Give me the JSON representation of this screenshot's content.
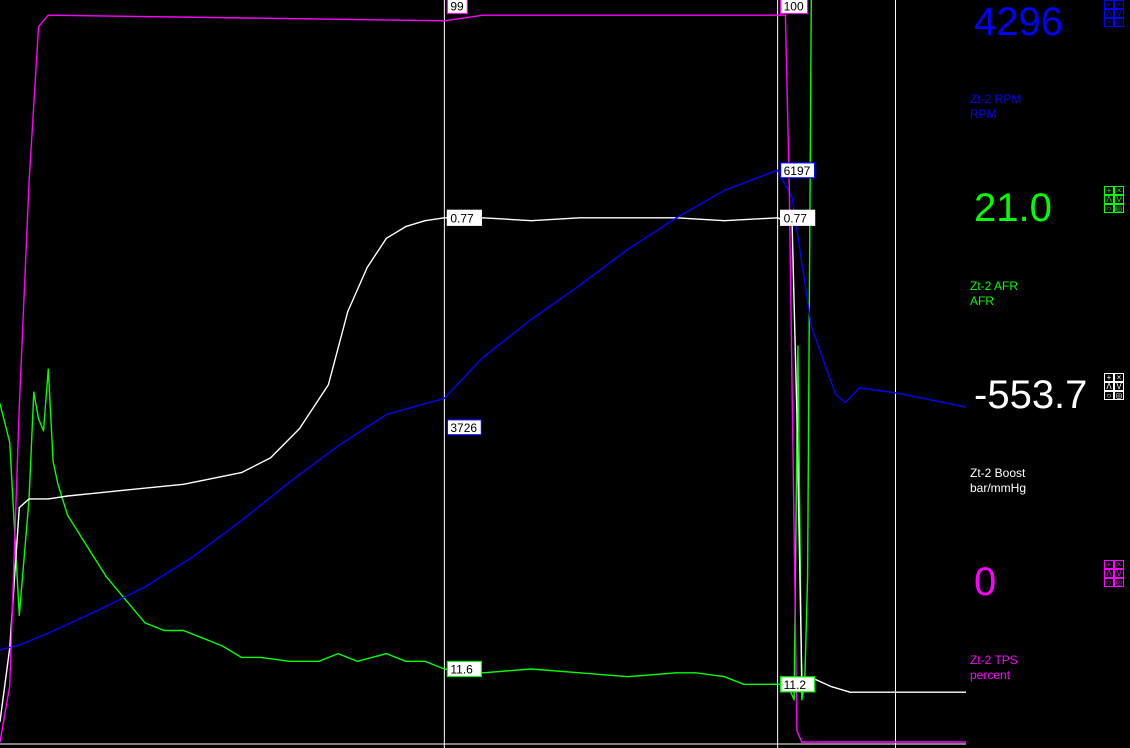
{
  "chart_data": {
    "type": "line",
    "x_range": [
      0,
      100
    ],
    "cursors": [
      {
        "x": 46,
        "values": {
          "tps": "99",
          "rpm": "3726",
          "boost": "0.77",
          "afr": "11.6"
        }
      },
      {
        "x": 80.5,
        "values": {
          "tps": "100",
          "rpm": "6197",
          "boost": "0.77",
          "afr": "11.2"
        }
      }
    ],
    "extra_gridline_x": 92.7,
    "series": [
      {
        "key": "rpm",
        "name": "Zt-2 RPM",
        "color": "#0000ff",
        "ylim": [
          0,
          8000
        ],
        "points": [
          [
            0,
            1000
          ],
          [
            2,
            1050
          ],
          [
            5,
            1180
          ],
          [
            10,
            1420
          ],
          [
            15,
            1680
          ],
          [
            20,
            2010
          ],
          [
            25,
            2400
          ],
          [
            30,
            2820
          ],
          [
            35,
            3210
          ],
          [
            40,
            3550
          ],
          [
            46,
            3726
          ],
          [
            50,
            4170
          ],
          [
            55,
            4580
          ],
          [
            60,
            4950
          ],
          [
            65,
            5340
          ],
          [
            70,
            5680
          ],
          [
            75,
            5980
          ],
          [
            80.5,
            6197
          ],
          [
            82,
            5900
          ],
          [
            84,
            4500
          ],
          [
            86.5,
            3770
          ],
          [
            87.5,
            3680
          ],
          [
            89,
            3840
          ],
          [
            93,
            3780
          ],
          [
            100,
            3630
          ]
        ]
      },
      {
        "key": "afr",
        "name": "Zt-2 AFR",
        "color": "#00ff00",
        "ylim": [
          9.7,
          28.9
        ],
        "points": [
          [
            0,
            18.5
          ],
          [
            1,
            17.5
          ],
          [
            2,
            13.0
          ],
          [
            3,
            16.0
          ],
          [
            3.5,
            18.8
          ],
          [
            4,
            18.1
          ],
          [
            4.5,
            17.8
          ],
          [
            5,
            19.4
          ],
          [
            5.5,
            17.0
          ],
          [
            6,
            16.4
          ],
          [
            7,
            15.6
          ],
          [
            9,
            14.8
          ],
          [
            11,
            14.0
          ],
          [
            13,
            13.4
          ],
          [
            15,
            12.8
          ],
          [
            17,
            12.6
          ],
          [
            19,
            12.6
          ],
          [
            21,
            12.4
          ],
          [
            23,
            12.2
          ],
          [
            25,
            11.9
          ],
          [
            27,
            11.9
          ],
          [
            30,
            11.8
          ],
          [
            33,
            11.8
          ],
          [
            35,
            12.0
          ],
          [
            37,
            11.8
          ],
          [
            40,
            12.0
          ],
          [
            42,
            11.8
          ],
          [
            44,
            11.8
          ],
          [
            46,
            11.6
          ],
          [
            50,
            11.5
          ],
          [
            55,
            11.6
          ],
          [
            60,
            11.5
          ],
          [
            65,
            11.4
          ],
          [
            70,
            11.5
          ],
          [
            72,
            11.5
          ],
          [
            75,
            11.4
          ],
          [
            77,
            11.2
          ],
          [
            80.5,
            11.2
          ],
          [
            81.5,
            11.2
          ],
          [
            82.2,
            10.8
          ],
          [
            82.6,
            20.0
          ],
          [
            83.0,
            10.8
          ],
          [
            83.3,
            11.2
          ],
          [
            83.6,
            14.0
          ],
          [
            84.0,
            29.5
          ],
          [
            85,
            30.0
          ]
        ]
      },
      {
        "key": "boost",
        "name": "Zt-2 Boost",
        "color": "#ffffff",
        "ylim": [
          -1.02,
          1.5
        ],
        "points": [
          [
            0,
            -0.95
          ],
          [
            1,
            -0.7
          ],
          [
            2,
            -0.22
          ],
          [
            3,
            -0.19
          ],
          [
            5,
            -0.19
          ],
          [
            7,
            -0.18
          ],
          [
            10,
            -0.17
          ],
          [
            13,
            -0.16
          ],
          [
            16,
            -0.15
          ],
          [
            19,
            -0.14
          ],
          [
            22,
            -0.12
          ],
          [
            25,
            -0.1
          ],
          [
            28,
            -0.05
          ],
          [
            31,
            0.05
          ],
          [
            34,
            0.2
          ],
          [
            36,
            0.45
          ],
          [
            38,
            0.6
          ],
          [
            40,
            0.7
          ],
          [
            42,
            0.74
          ],
          [
            44,
            0.76
          ],
          [
            46,
            0.77
          ],
          [
            50,
            0.77
          ],
          [
            55,
            0.76
          ],
          [
            60,
            0.77
          ],
          [
            65,
            0.77
          ],
          [
            70,
            0.77
          ],
          [
            75,
            0.76
          ],
          [
            80.5,
            0.77
          ],
          [
            82,
            0.75
          ],
          [
            82.5,
            0.1
          ],
          [
            83,
            -0.8
          ],
          [
            84,
            -0.8
          ],
          [
            86,
            -0.83
          ],
          [
            88,
            -0.85
          ],
          [
            92,
            -0.85
          ],
          [
            100,
            -0.85
          ]
        ]
      },
      {
        "key": "tps",
        "name": "Zt-2 TPS",
        "color": "#ff00ff",
        "ylim": [
          -30,
          102
        ],
        "points": [
          [
            0,
            -30
          ],
          [
            1,
            -20
          ],
          [
            2,
            30
          ],
          [
            3,
            70
          ],
          [
            4,
            98
          ],
          [
            5,
            100
          ],
          [
            46,
            99
          ],
          [
            50,
            100
          ],
          [
            80.5,
            100
          ],
          [
            81.3,
            100
          ],
          [
            81.7,
            70
          ],
          [
            82.5,
            -28
          ],
          [
            83,
            -30
          ],
          [
            100,
            -30
          ]
        ]
      }
    ]
  },
  "panel": {
    "channels": [
      {
        "key": "rpm",
        "value": "4296",
        "name": "Zt-2 RPM",
        "unit": "RPM",
        "color": "#0000ff"
      },
      {
        "key": "afr",
        "value": "21.0",
        "name": "Zt-2 AFR",
        "unit": "AFR",
        "color": "#00ff00"
      },
      {
        "key": "boost",
        "value": "-553.7",
        "name": "Zt-2 Boost",
        "unit": "bar/mmHg",
        "color": "#ffffff"
      },
      {
        "key": "tps",
        "value": "0",
        "name": "Zt-2 TPS",
        "unit": "percent",
        "color": "#ff00ff"
      }
    ]
  }
}
